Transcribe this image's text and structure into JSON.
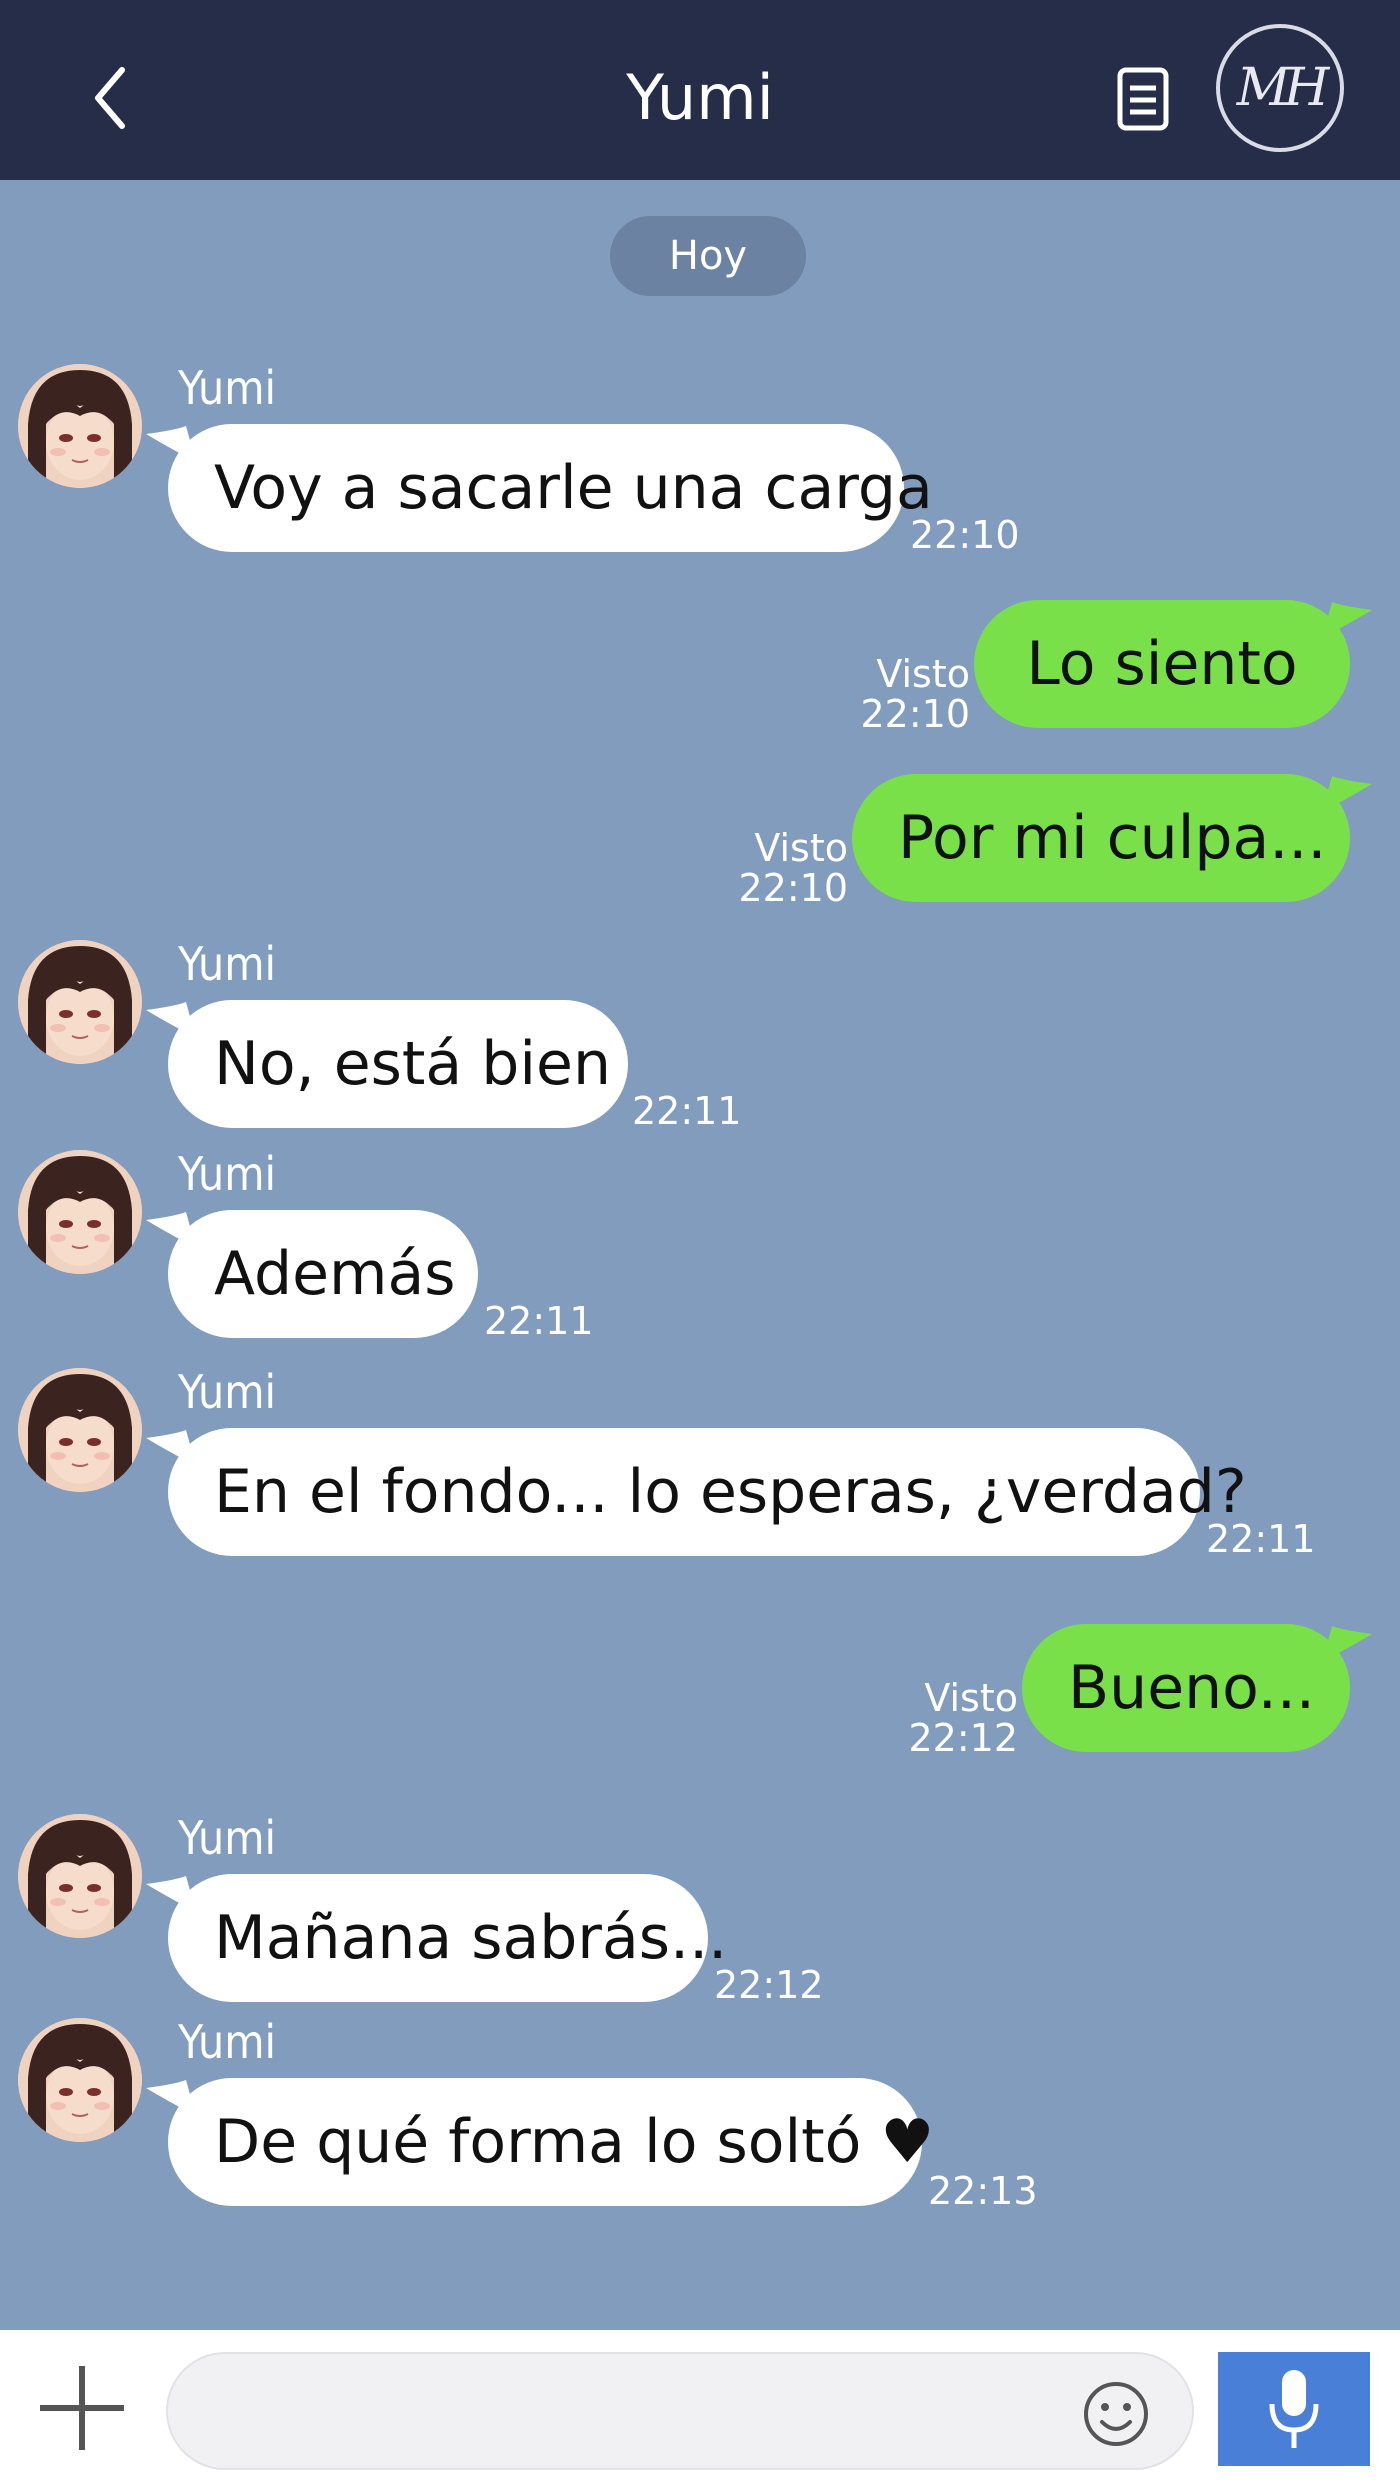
{
  "header": {
    "title": "Yumi",
    "logo_text": "MH",
    "colors": {
      "background": "#252d48",
      "text": "#ffffff"
    }
  },
  "date_separator": "Hoy",
  "messages": [
    {
      "direction": "in",
      "sender": "Yumi",
      "text": "Voy a sacarle una carga",
      "time": "22:10"
    },
    {
      "direction": "out",
      "text": "Lo siento",
      "status": "Visto",
      "time": "22:10"
    },
    {
      "direction": "out",
      "text": "Por mi culpa...",
      "status": "Visto",
      "time": "22:10"
    },
    {
      "direction": "in",
      "sender": "Yumi",
      "text": "No, está bien",
      "time": "22:11"
    },
    {
      "direction": "in",
      "sender": "Yumi",
      "text": "Además",
      "time": "22:11"
    },
    {
      "direction": "in",
      "sender": "Yumi",
      "text": "En el fondo... lo esperas, ¿verdad?",
      "time": "22:11"
    },
    {
      "direction": "out",
      "text": "Bueno...",
      "status": "Visto",
      "time": "22:12"
    },
    {
      "direction": "in",
      "sender": "Yumi",
      "text": "Mañana sabrás...",
      "time": "22:12"
    },
    {
      "direction": "in",
      "sender": "Yumi",
      "text": "De qué forma lo soltó ♥",
      "time": "22:13"
    }
  ],
  "composer": {
    "input_value": "",
    "placeholder": "",
    "icons": [
      "plus-icon",
      "emoji-icon",
      "microphone-icon"
    ]
  },
  "colors": {
    "chat_background": "#819cbc",
    "incoming_bubble": "#ffffff",
    "outgoing_bubble": "#79e04a",
    "mic_button": "#4a7fd8"
  }
}
